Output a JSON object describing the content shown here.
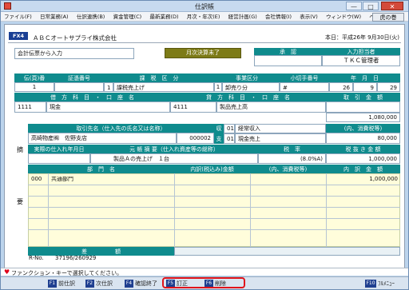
{
  "window": {
    "title": "仕訳帳",
    "minimize": "—",
    "maximize": "□",
    "close": "✕"
  },
  "menu": [
    "ファイル(F)",
    "日常業務(A)",
    "仕訳連携(B)",
    "資金管理(C)",
    "最新業務(D)",
    "月次・年次(E)",
    "経営計画(G)",
    "会社情報(I)",
    "表示(V)",
    "ウィンドウ(W)",
    "ヘルプ(H)"
  ],
  "tora_button": "虎の巻",
  "header": {
    "fx4": "FX4",
    "company": "ＡＢＣオートサプライ株式会社",
    "today": "本日：平成26年 9月30日(火)"
  },
  "entry_mode": {
    "label": "会計伝票から入力",
    "closing_button": "月次決算未了",
    "approval_header": "承　認",
    "inputter_header": "入力担当者",
    "inputter_value": "ＴＫＣ管理者"
  },
  "voucher_headers": {
    "no": "伝(頁)番",
    "proof": "証憑番号",
    "tax_class": "課　税　区　分",
    "business": "事業区分",
    "check_no": "小切手番号",
    "date": "年　月　日"
  },
  "voucher_values": {
    "no": "1",
    "tax_code": "1",
    "tax_label": "課税売上げ",
    "business_code": "1",
    "business_label": "卸売り分",
    "check_no": "#",
    "year": "26",
    "month": "9",
    "day": "29"
  },
  "account_headers": {
    "debit": "借　方　科　目　・　口　座　名",
    "credit": "貸　方　科　目　・　口　座　名",
    "amount": "取　引　金　額"
  },
  "account_values": {
    "debit_code": "1111",
    "debit_name": "現金",
    "credit_code": "4111",
    "credit_name": "製品売上高",
    "amount": "1,080,000"
  },
  "partner": {
    "header": "取引先名（仕入先の氏名又は名称）",
    "name": "高崎物産㈱　佐野支店",
    "code": "000002",
    "recv_mark": "収",
    "pay_mark": "支",
    "recv_code": "01",
    "recv_label": "経常収入",
    "pay_code": "01",
    "pay_label": "現金売上",
    "tax_header": "(内、消費税等)",
    "tax_amount": "80,000"
  },
  "summary_side_top": "摘",
  "summary_side_bottom": "要",
  "detail_headers": {
    "date": "実際の仕入れ年月日",
    "desc": "元 帳 摘 要（仕入れ資産等の総称）",
    "tax_rate": "税　率",
    "amount_ex": "税 抜 き 金 額"
  },
  "detail_values": {
    "desc": "製品Ａの売上げ　１台",
    "tax_rate": "(8.0%A)",
    "amount_ex": "1,000,000"
  },
  "dept_headers": {
    "dept": "部　門　名",
    "incl": "内訳(税込み)金額",
    "tax": "(内、消費税等)",
    "breakdown": "内　訳　金　額"
  },
  "dept_rows": [
    {
      "code": "000",
      "name": "共通部門",
      "incl": "",
      "tax": "",
      "breakdown": "1,000,000"
    }
  ],
  "difference": {
    "label": "差　　　　　額"
  },
  "record": {
    "label": "R-No.",
    "value": "37196/260929"
  },
  "status": {
    "heart": "♥",
    "message": "ファンクション・キーで選択してください。"
  },
  "fkeys": [
    {
      "key": "F1",
      "label": "前仕訳"
    },
    {
      "key": "F2",
      "label": "次仕訳"
    },
    {
      "key": "F4",
      "label": "確認終了"
    },
    {
      "key": "F5",
      "label": "訂正"
    },
    {
      "key": "F6",
      "label": "削除"
    },
    {
      "key": "F10",
      "label": "ﾌﾙﾒﾆｭｰ"
    }
  ],
  "colors": {
    "teal_header": "#0f8b8d",
    "khaki_button": "#7d7b17",
    "yellow_field": "#fffddb",
    "highlight_box": "#e0141b",
    "fkey_badge": "#1f3f90"
  }
}
